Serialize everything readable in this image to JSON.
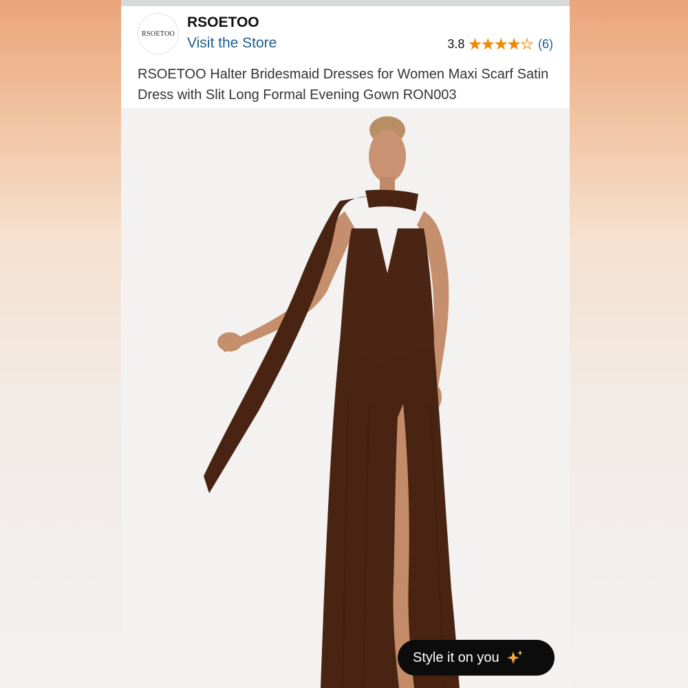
{
  "store": {
    "logo_text": "RSOETOO",
    "name": "RSOETOO",
    "visit_label": "Visit the Store"
  },
  "rating": {
    "value": "3.8",
    "stars_filled_fraction": 0.76,
    "count": "(6)"
  },
  "product": {
    "title": "RSOETOO Halter Bridesmaid Dresses for Women Maxi Scarf Satin Dress with Slit Long Formal Evening Gown RON003"
  },
  "style_button": {
    "label": "Style it on you",
    "icon": "sparkle-icon"
  },
  "colors": {
    "link": "#1b5f8d",
    "star": "#f08804",
    "dress": "#4a2412"
  }
}
